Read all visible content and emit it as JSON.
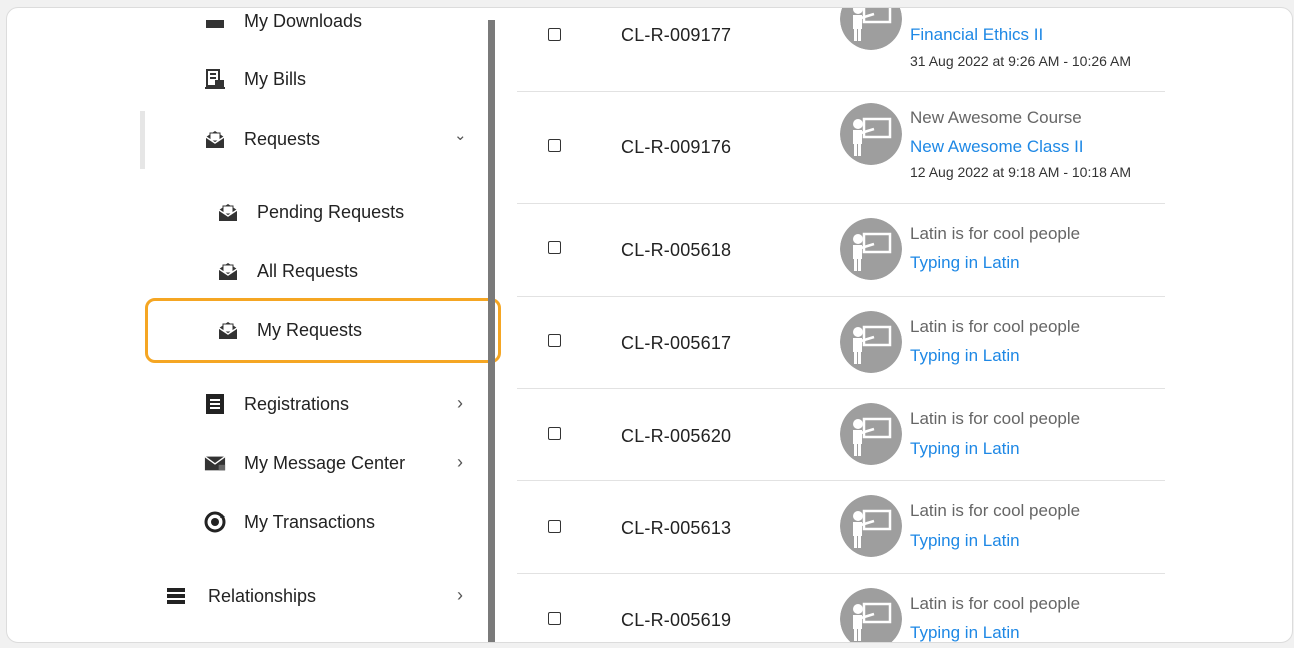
{
  "sidebar": {
    "items": [
      {
        "label": "My Downloads",
        "icon": "download-icon"
      },
      {
        "label": "My Bills",
        "icon": "bill-icon"
      },
      {
        "label": "Requests",
        "icon": "requests-icon",
        "chevron": "⌄"
      },
      {
        "label": "Pending Requests",
        "icon": "requests-icon"
      },
      {
        "label": "All Requests",
        "icon": "requests-icon"
      },
      {
        "label": "My Requests",
        "icon": "requests-icon"
      },
      {
        "label": "Registrations",
        "icon": "registrations-icon",
        "chevron": "›"
      },
      {
        "label": "My Message Center",
        "icon": "mail-icon",
        "chevron": "›"
      },
      {
        "label": "My Transactions",
        "icon": "transactions-icon"
      },
      {
        "label": "Relationships",
        "icon": "relationships-icon",
        "chevron": "›"
      }
    ],
    "highlighted_item": "My Requests"
  },
  "table": {
    "rows": [
      {
        "id": "CL-R-009177",
        "course": "",
        "class": "Financial Ethics II",
        "datetime": "31 Aug 2022 at 9:26 AM - 10:26 AM"
      },
      {
        "id": "CL-R-009176",
        "course": "New Awesome Course",
        "class": "New Awesome Class II",
        "datetime": "12 Aug 2022 at 9:18 AM - 10:18 AM"
      },
      {
        "id": "CL-R-005618",
        "course": "Latin is for cool people",
        "class": "Typing in Latin",
        "datetime": ""
      },
      {
        "id": "CL-R-005617",
        "course": "Latin is for cool people",
        "class": "Typing in Latin",
        "datetime": ""
      },
      {
        "id": "CL-R-005620",
        "course": "Latin is for cool people",
        "class": "Typing in Latin",
        "datetime": ""
      },
      {
        "id": "CL-R-005613",
        "course": "Latin is for cool people",
        "class": "Typing in Latin",
        "datetime": ""
      },
      {
        "id": "CL-R-005619",
        "course": "Latin is for cool people",
        "class": "Typing in Latin",
        "datetime": ""
      }
    ]
  },
  "colors": {
    "highlight": "#f5a623",
    "link": "#1e88e5",
    "avatar": "#9e9e9e"
  }
}
